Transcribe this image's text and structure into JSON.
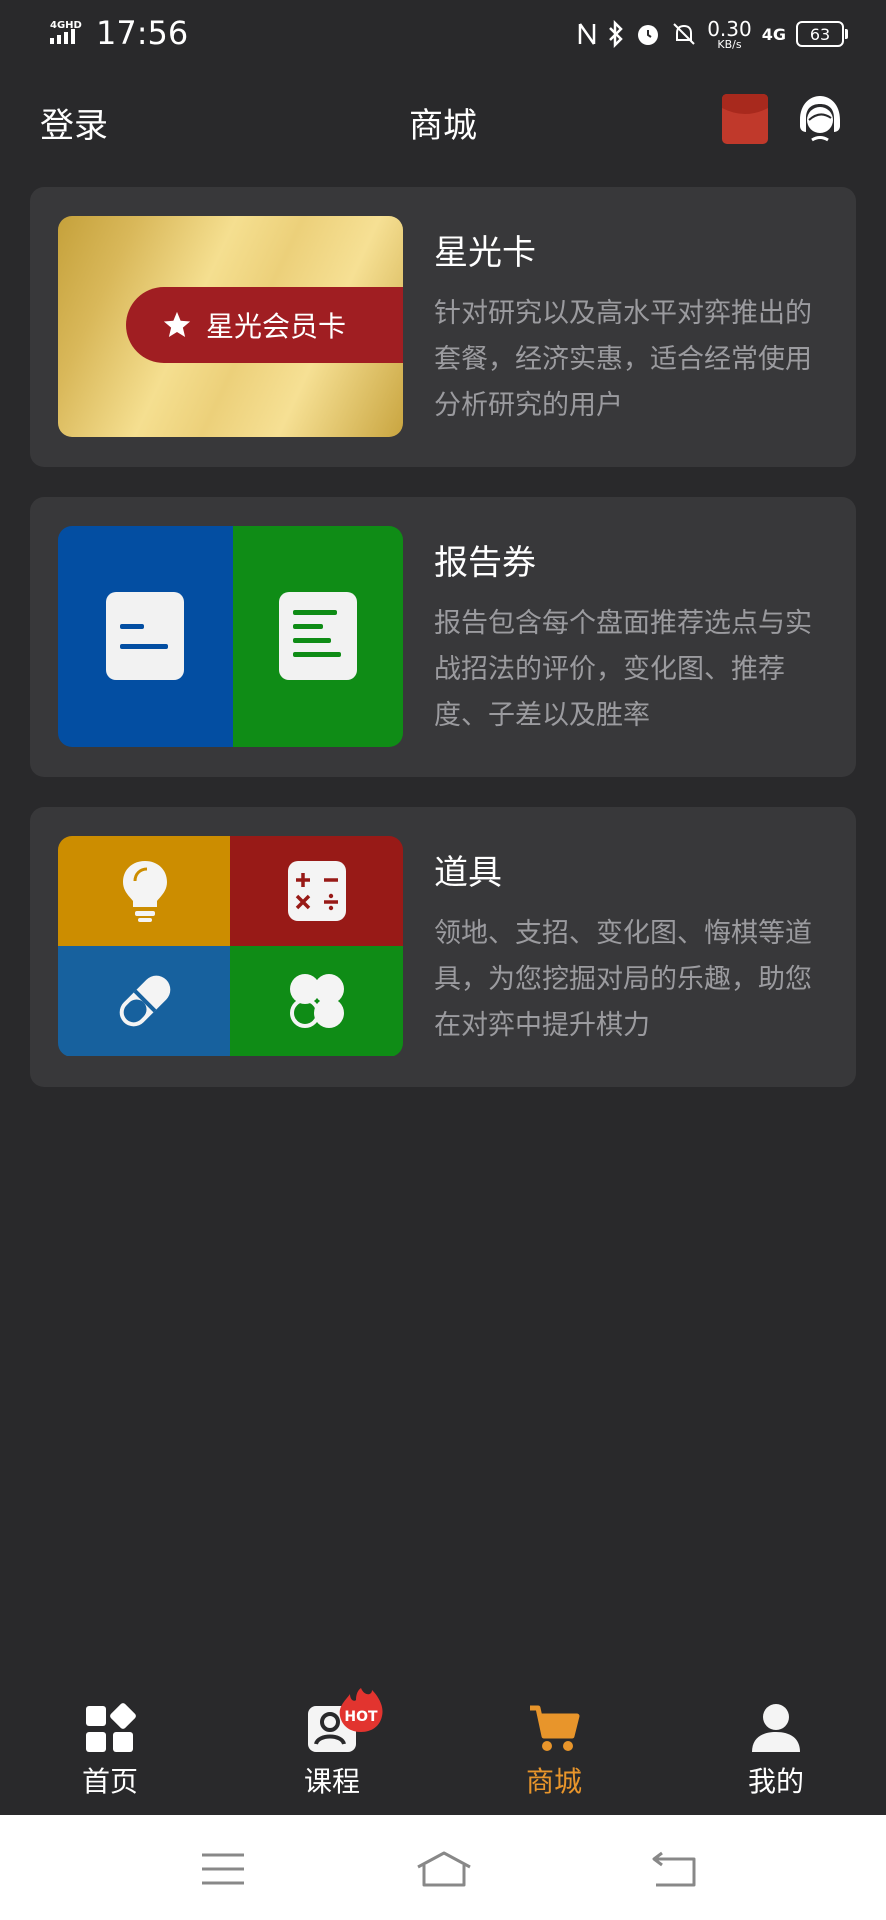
{
  "status_bar": {
    "network_type": "4GHD",
    "time": "17:56",
    "speed_value": "0.30",
    "speed_unit": "KB/s",
    "net_label": "4G",
    "battery": "63"
  },
  "header": {
    "login_label": "登录",
    "title": "商城",
    "envelope_color": "#c0392b"
  },
  "cards": [
    {
      "title": "星光卡",
      "description": "针对研究以及高水平对弈推出的套餐，经济实惠，适合经常使用分析研究的用户",
      "badge_text": "星光会员卡"
    },
    {
      "title": "报告券",
      "description": "报告包含每个盘面推荐选点与实战招法的评价，变化图、推荐度、子差以及胜率"
    },
    {
      "title": "道具",
      "description": "领地、支招、变化图、悔棋等道具，为您挖掘对局的乐趣，助您在对弈中提升棋力"
    }
  ],
  "bottom_nav": {
    "items": [
      {
        "label": "首页",
        "icon": "home-grid-icon",
        "active": false
      },
      {
        "label": "课程",
        "icon": "course-icon",
        "active": false,
        "badge": "HOT"
      },
      {
        "label": "商城",
        "icon": "cart-icon",
        "active": true
      },
      {
        "label": "我的",
        "icon": "user-icon",
        "active": false
      }
    ],
    "active_color": "#e8952b"
  },
  "system_nav": {
    "icons": [
      "menu-icon",
      "home-icon",
      "back-icon"
    ]
  }
}
